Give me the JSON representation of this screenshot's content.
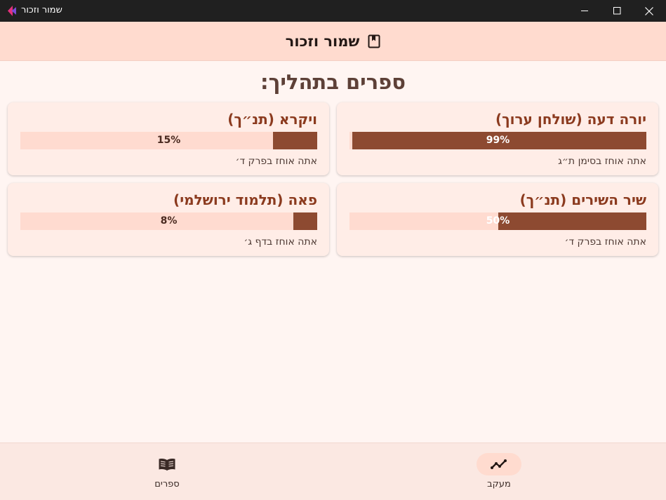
{
  "window": {
    "title": "שמור וזכור"
  },
  "header": {
    "title": "שמור וזכור",
    "icon": "bookmark-book-icon"
  },
  "section_title": "ספרים בתהליך:",
  "books": [
    {
      "title": "יורה דעה (שולחן ערוך)",
      "progress": 99,
      "progress_label": "99%",
      "position_text": "אתה אוחז בסימן ת״ג"
    },
    {
      "title": "ויקרא (תנ״ך)",
      "progress": 15,
      "progress_label": "15%",
      "position_text": "אתה אוחז בפרק ד׳"
    },
    {
      "title": "שיר השירים (תנ״ך)",
      "progress": 50,
      "progress_label": "50%",
      "position_text": "אתה אוחז בפרק ד׳"
    },
    {
      "title": "פאה (תלמוד ירושלמי)",
      "progress": 8,
      "progress_label": "8%",
      "position_text": "אתה אוחז בדף ג׳"
    }
  ],
  "nav": {
    "tracking": {
      "label": "מעקב",
      "icon": "trending-icon",
      "active": true
    },
    "books": {
      "label": "ספרים",
      "icon": "open-book-icon",
      "active": false
    }
  },
  "colors": {
    "header_bg": "#ffdbcf",
    "accent": "#8d4a31",
    "card_bg": "#ffede7",
    "track_bg": "#ffdbd0"
  }
}
